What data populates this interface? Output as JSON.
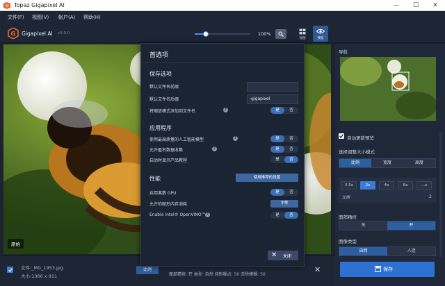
{
  "window": {
    "title": "Topaz Gigapixel AI",
    "minimize": "—",
    "maximize": "☐",
    "close": "✕"
  },
  "menu": [
    "文件(F)",
    "视图(V)",
    "帐户(A)",
    "帮助(H)"
  ],
  "toolbar": {
    "app_name": "Gigapixel AI",
    "version": "v5.0.0",
    "zoom_value": "100%",
    "view_label": "视图",
    "preview_label": "预览"
  },
  "canvas": {
    "original_label": "原始"
  },
  "right_panel": {
    "navigator_label": "导航",
    "auto_update_label": "自动更新预览",
    "resize_mode_label": "选择调整大小模式",
    "resize_modes": [
      "比例",
      "宽度",
      "高度"
    ],
    "scale_options": [
      "0.5x",
      "2x",
      "4x",
      "6x",
      "...x"
    ],
    "scale_label": "比例",
    "scale_value": "2",
    "face_refine_label": "面部精修",
    "face_refine_options": [
      "关",
      "开"
    ],
    "image_type_label": "图像类型",
    "image_type_options": [
      "自然",
      "人造"
    ],
    "save_label": "保存"
  },
  "bottom": {
    "file_name": "文件:_MG_1953.jpg",
    "file_size": "大小:1366 x 911",
    "scale_button": "比例",
    "info_line2": "面部精修: 开  类型: 自然  抑制噪点: 50  去除模糊: 50"
  },
  "modal": {
    "title": "首选项",
    "save_section": "保存选项",
    "prefix_label": "默认文件名前缀",
    "prefix_value": "",
    "suffix_label": "默认文件名后缀",
    "suffix_value": "-gigapixel",
    "add_scale_label": "将缩放模式添加到文件名",
    "app_section": "应用程序",
    "best_model_label": "使用最高质量的人工智能模型",
    "anon_data_label": "允许匿名数据收集",
    "show_tutorial_label": "启动时显示产品教程",
    "perf_section": "性能",
    "recommended_button": "使用推荐的设置",
    "discrete_gpu_label": "启用离散 GPU",
    "memory_label": "允许的图形内存消耗",
    "memory_value": "中等",
    "openvino_label": "Enable Intel® OpenVINO™",
    "yes": "是",
    "no": "否",
    "close_label": "关闭"
  },
  "colors": {
    "accent": "#3a7bd5",
    "panel_bg": "#1f2838",
    "modal_bg": "#1b2433"
  }
}
